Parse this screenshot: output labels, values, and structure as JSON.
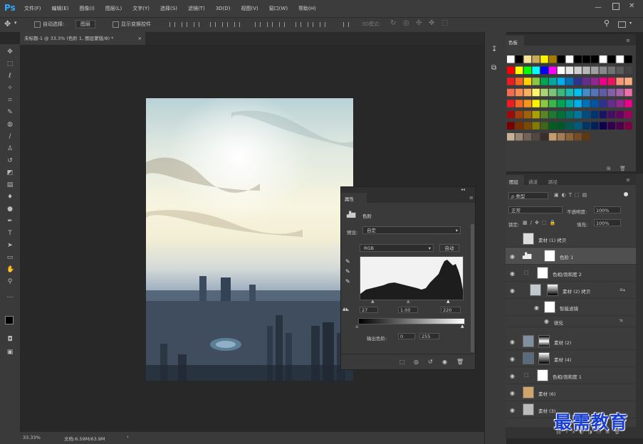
{
  "app": {
    "logo": "Ps"
  },
  "menu": [
    "文件(F)",
    "编辑(E)",
    "图像(I)",
    "图层(L)",
    "文字(Y)",
    "选择(S)",
    "滤镜(T)",
    "3D(D)",
    "视图(V)",
    "窗口(W)",
    "帮助(H)"
  ],
  "options_bar": {
    "auto_select_label": "自动选择:",
    "auto_select_value": "图层",
    "show_transform_label": "显示变换控件",
    "mode_3d_label": "3D模式:"
  },
  "document_tab": {
    "title": "未标题-1 @ 33.3% (色阶 1, 图层蒙版/8) *",
    "close": "×"
  },
  "status_bar": {
    "zoom": "33.33%",
    "doc_size": "文档:6.59M/63.9M",
    "arrow": "›"
  },
  "swatches_panel": {
    "title": "色板"
  },
  "properties_panel": {
    "title": "属性",
    "adjustment_name": "色阶",
    "preset_label": "预设:",
    "preset_value": "自定",
    "channel": "RGB",
    "auto_button": "自动",
    "input_black": "27",
    "input_gamma": "1.00",
    "input_white": "220",
    "output_label": "输出色阶:",
    "output_black": "0",
    "output_white": "255"
  },
  "layers_panel": {
    "tabs": [
      "图层",
      "通道",
      "路径"
    ],
    "kind_filter": "ρ 类型",
    "blend_mode": "正常",
    "opacity_label": "不透明度:",
    "opacity_value": "100%",
    "lock_label": "锁定:",
    "fill_label": "填充:",
    "fill_value": "100%",
    "layers": [
      {
        "name": "素材 (1) 拷贝"
      },
      {
        "name": "色阶 1"
      },
      {
        "name": "色相/饱和度 2"
      },
      {
        "name": "素材 (2) 拷贝"
      },
      {
        "name": "智能滤镜"
      },
      {
        "name": "锐化"
      },
      {
        "name": "素材 (2)"
      },
      {
        "name": "素材 (4)"
      },
      {
        "name": "色相/饱和度 1"
      },
      {
        "name": "素材 (6)"
      },
      {
        "name": "素材 (3)"
      }
    ]
  },
  "watermark": "最需教育",
  "colors": {
    "chrome": "#3a3a3a",
    "canvas": "#282828",
    "accent": "#31a8ff",
    "watermark": "#1a3fd1"
  }
}
